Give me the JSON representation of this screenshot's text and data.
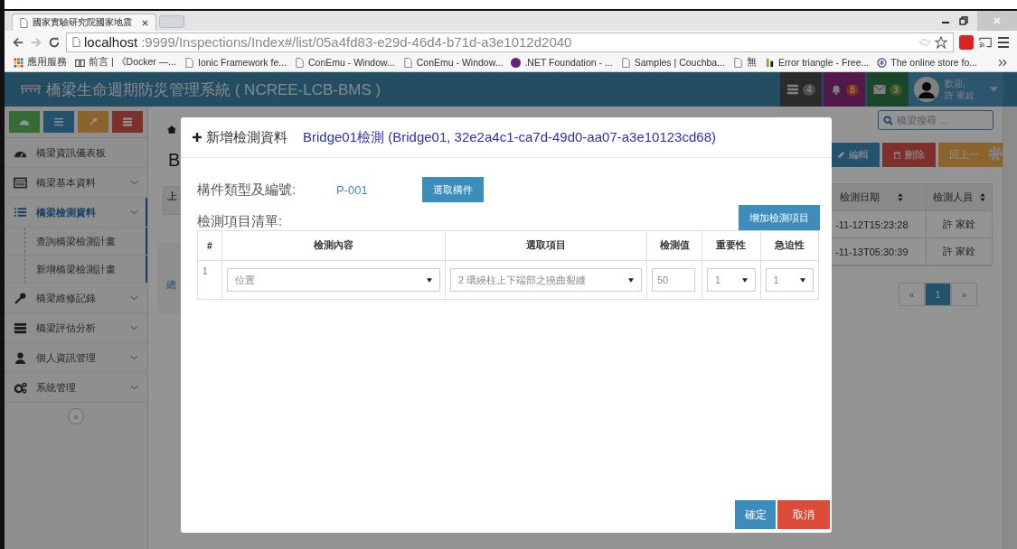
{
  "browser": {
    "tab_title": "國家實驗研究院國家地震",
    "url_host": "localhost",
    "url_rest": ":9999/Inspections/Index#/list/05a4fd83-e29d-46d4-b71d-a3e1012d2040",
    "bookmarks": [
      {
        "kind": "apps",
        "label": "應用服務"
      },
      {
        "kind": "book",
        "label": "前言 | 《Docker —..."
      },
      {
        "kind": "page",
        "label": "Ionic Framework fe..."
      },
      {
        "kind": "page",
        "label": "ConEmu - Window..."
      },
      {
        "kind": "page",
        "label": "ConEmu - Window..."
      },
      {
        "kind": "dotnet",
        "label": ".NET Foundation - ..."
      },
      {
        "kind": "page",
        "label": "Samples | Couchba..."
      },
      {
        "kind": "page",
        "label": "無"
      },
      {
        "kind": "fi",
        "label": "Error triangle - Free..."
      },
      {
        "kind": "globe",
        "label": "The online store fo..."
      }
    ]
  },
  "app": {
    "title": "橋梁生命週期防災管理系統 ( NCREE-LCB-BMS )",
    "notifications": [
      {
        "kind": "tasks",
        "count": "4"
      },
      {
        "kind": "bell",
        "count": "8"
      },
      {
        "kind": "mail",
        "count": "3"
      }
    ],
    "user": {
      "greeting": "歡迎,",
      "name": "許 家銓"
    }
  },
  "sidebar": {
    "quick_buttons": [
      {
        "kind": "dashboard"
      },
      {
        "kind": "list"
      },
      {
        "kind": "wrench"
      },
      {
        "kind": "server"
      }
    ],
    "items": [
      {
        "kind": "dashboard",
        "label": "橋梁資訊儀表板",
        "selected": false,
        "chevron": false
      },
      {
        "kind": "card",
        "label": "橋梁基本資料",
        "selected": false,
        "chevron": true
      },
      {
        "kind": "list",
        "label": "橋梁檢測資料",
        "selected": true,
        "chevron": true,
        "children": [
          {
            "label": "查詢橋梁檢測計畫"
          },
          {
            "label": "新增橋梁檢測計畫"
          }
        ]
      },
      {
        "kind": "wrench",
        "label": "橋梁維修記錄",
        "selected": false,
        "chevron": true
      },
      {
        "kind": "server",
        "label": "橋梁評估分析",
        "selected": false,
        "chevron": true
      },
      {
        "kind": "user",
        "label": "個人資訊管理",
        "selected": false,
        "chevron": true
      },
      {
        "kind": "gears",
        "label": "系統管理",
        "selected": false,
        "chevron": true
      }
    ],
    "collapse": "«"
  },
  "page": {
    "heading": "B",
    "fragment_top": "上",
    "fragment_bottom": "總",
    "search_placeholder": "橋梁搜尋 ...",
    "actions": [
      {
        "kind": "edit",
        "label": "編輯"
      },
      {
        "kind": "delete",
        "label": "刪除"
      },
      {
        "kind": "back",
        "label": "回上一"
      }
    ],
    "table": {
      "columns": [
        "檢測日期",
        "檢測人員"
      ],
      "rows": [
        [
          "-11-12T15:23:28",
          "許 家銓"
        ],
        [
          "-11-13T05:30:39",
          "許 家銓"
        ]
      ]
    },
    "pagination": [
      {
        "label": "«",
        "selected": false
      },
      {
        "label": "1",
        "selected": true
      },
      {
        "label": "»",
        "selected": false
      }
    ]
  },
  "modal": {
    "title": "新增檢測資料",
    "subtitle": "Bridge01檢測 (Bridge01, 32e2a4c1-ca7d-49d0-aa07-a3e10123cd68)",
    "component_label": "構件類型及編號:",
    "component_value": "P-001",
    "pick_button": "選取構件",
    "list_label": "檢測項目清單:",
    "add_button": "增加檢測項目",
    "columns": [
      "#",
      "檢測內容",
      "選取項目",
      "檢測值",
      "重要性",
      "急迫性"
    ],
    "rows": [
      {
        "index": "1",
        "content": "位置",
        "item": "2 環繞柱上下端部之撓曲裂縫",
        "value": "50",
        "importance": "1",
        "urgency": "1"
      }
    ],
    "ok": "確定",
    "cancel": "取消"
  }
}
